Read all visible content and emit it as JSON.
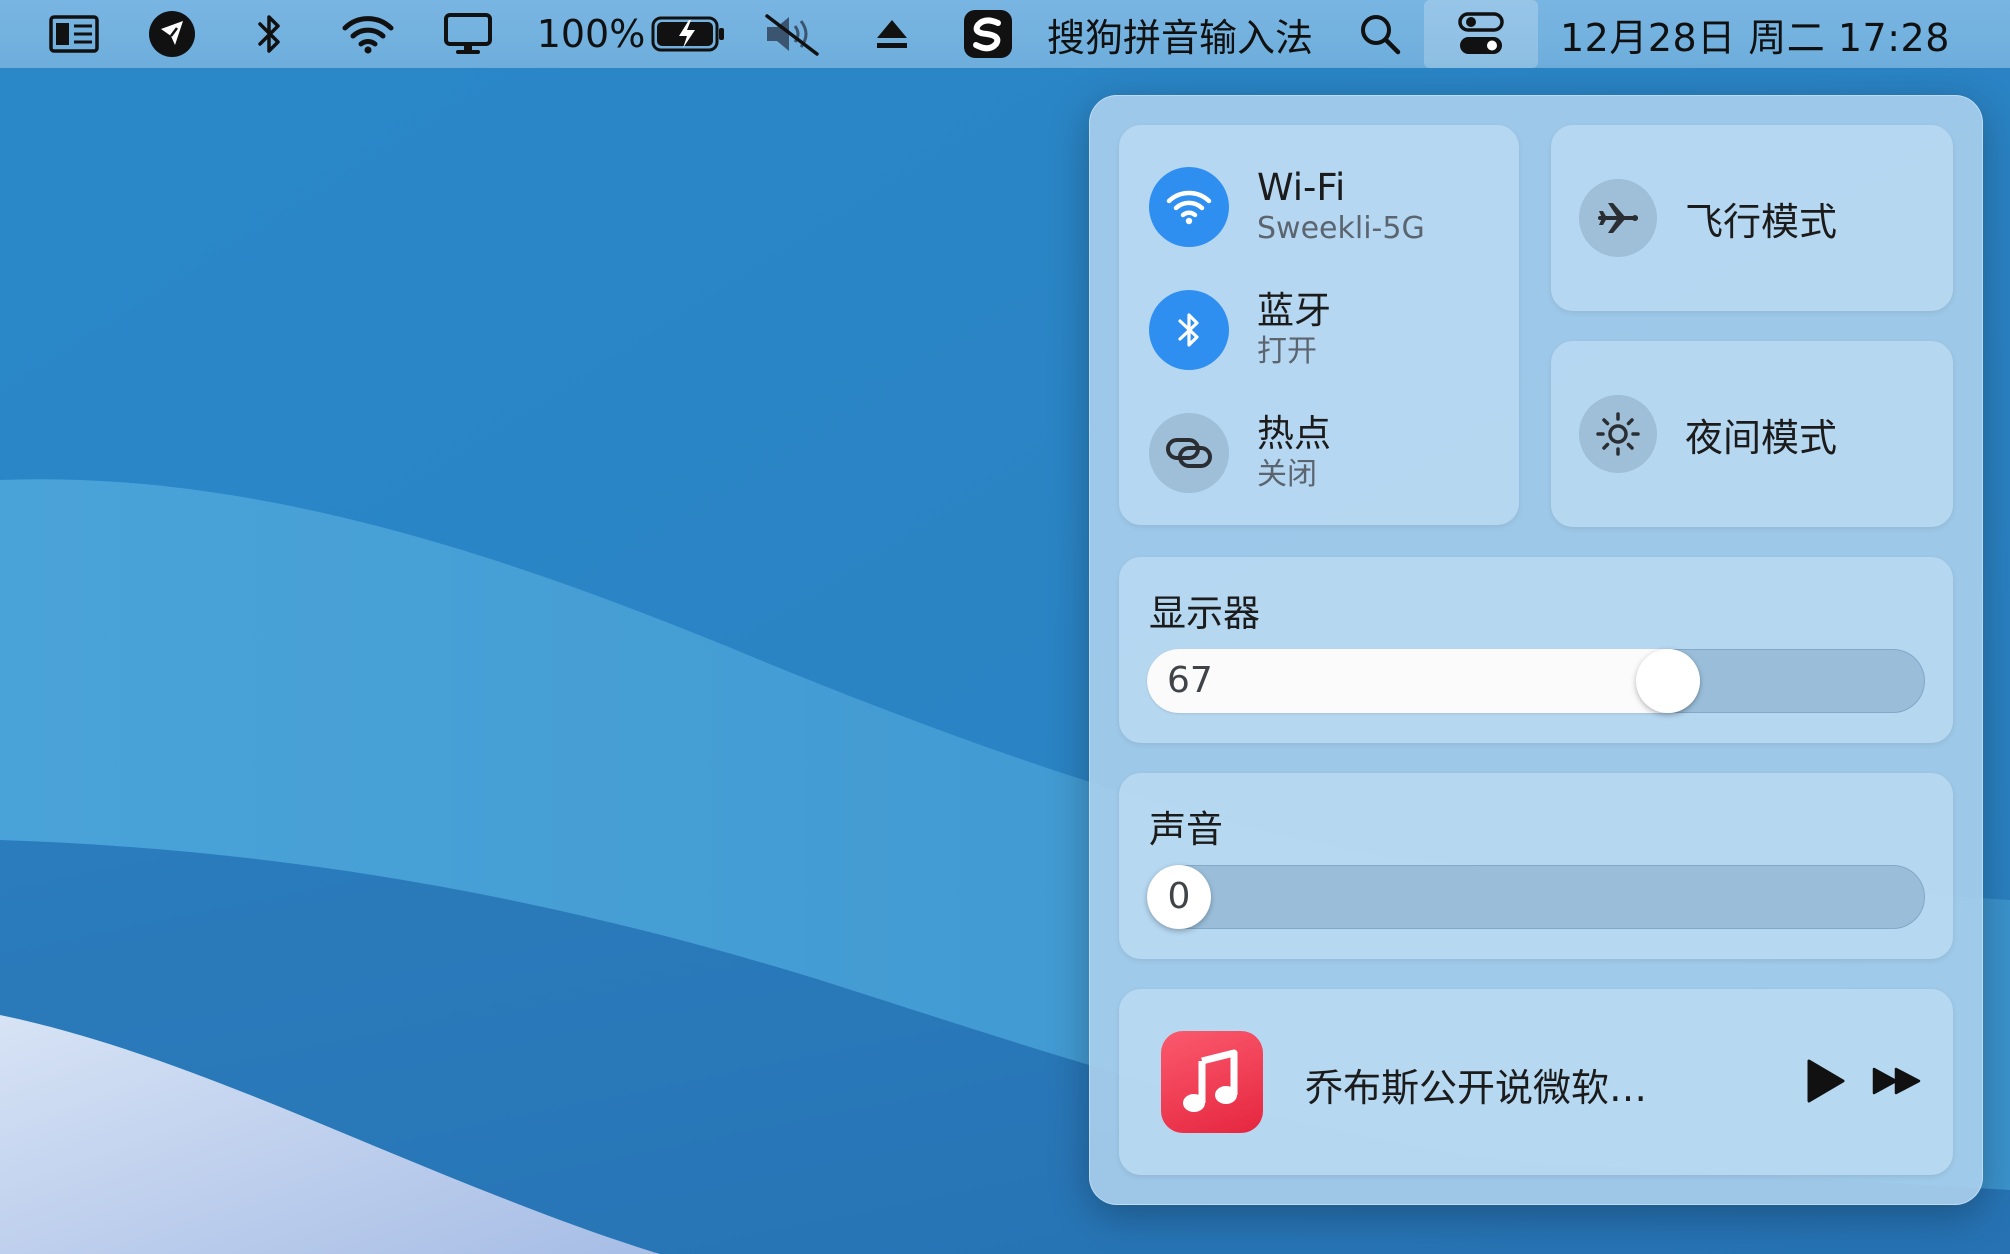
{
  "menubar": {
    "battery_percent": "100%",
    "input_method_name": "搜狗拼音输入法",
    "clock": "12月28日 周二 17:28",
    "icons": [
      "reader-view-icon",
      "app-badge-icon",
      "bluetooth-icon",
      "wifi-icon",
      "display-icon",
      "battery-icon",
      "volume-muted-icon",
      "eject-icon",
      "sogou-icon",
      "search-icon",
      "control-center-icon"
    ]
  },
  "control_center": {
    "wifi": {
      "title": "Wi-Fi",
      "status": "Sweekli-5G",
      "enabled": true
    },
    "bluetooth": {
      "title": "蓝牙",
      "status": "打开",
      "enabled": true
    },
    "hotspot": {
      "title": "热点",
      "status": "关闭",
      "enabled": false
    },
    "airplane": {
      "label": "飞行模式",
      "enabled": false
    },
    "night_mode": {
      "label": "夜间模式",
      "enabled": false
    },
    "display": {
      "title": "显示器",
      "value": "67",
      "level": 0.67
    },
    "sound": {
      "title": "声音",
      "value": "0",
      "level": 0
    },
    "now_playing": {
      "title": "乔布斯公开说微软…"
    }
  },
  "colors": {
    "accent": "#2e8ff0",
    "music_app": "#f0364c",
    "panel": "#a8ceeb"
  }
}
